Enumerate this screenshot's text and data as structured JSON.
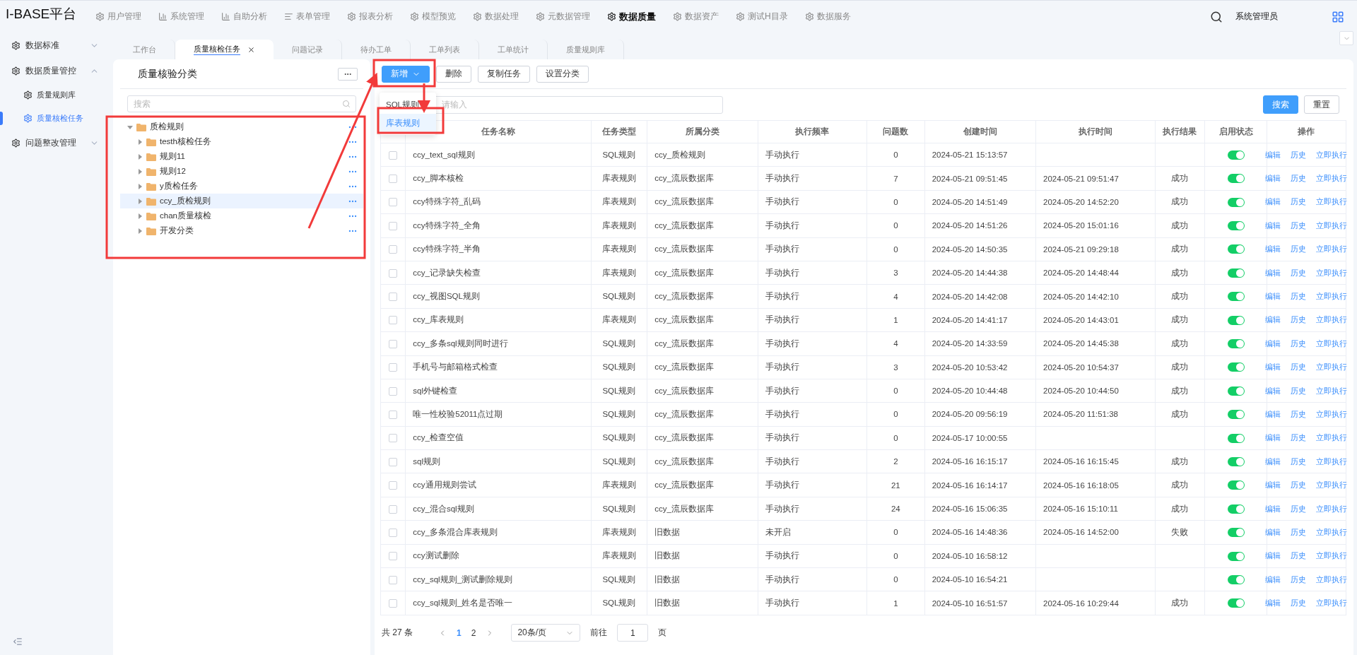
{
  "app": {
    "title": "I-BASE平台"
  },
  "nav": [
    {
      "label": "用户管理",
      "kind": "gear",
      "selected": false
    },
    {
      "label": "系统管理",
      "kind": "bars",
      "selected": false
    },
    {
      "label": "自助分析",
      "kind": "bars",
      "selected": false
    },
    {
      "label": "表单管理",
      "kind": "list",
      "selected": false
    },
    {
      "label": "报表分析",
      "kind": "gear",
      "selected": false
    },
    {
      "label": "模型预览",
      "kind": "gear",
      "selected": false
    },
    {
      "label": "数据处理",
      "kind": "gear",
      "selected": false
    },
    {
      "label": "元数据管理",
      "kind": "gear",
      "selected": false
    },
    {
      "label": "数据质量",
      "kind": "gear",
      "selected": true
    },
    {
      "label": "数据资产",
      "kind": "gear",
      "selected": false
    },
    {
      "label": "测试H目录",
      "kind": "gear",
      "selected": false
    },
    {
      "label": "数据服务",
      "kind": "gear",
      "selected": false
    }
  ],
  "user": {
    "name": "系统管理员"
  },
  "tabs": [
    {
      "label": "工作台",
      "selected": false
    },
    {
      "label": "质量核检任务",
      "selected": true
    },
    {
      "label": "问题记录",
      "selected": false
    },
    {
      "label": "待办工单",
      "selected": false
    },
    {
      "label": "工单列表",
      "selected": false
    },
    {
      "label": "工单统计",
      "selected": false
    },
    {
      "label": "质量规则库",
      "selected": false
    }
  ],
  "sidebar": {
    "items": [
      {
        "label": "数据标准",
        "expanded": false
      },
      {
        "label": "数据质量管控",
        "expanded": true,
        "children": [
          {
            "label": "质量规则库",
            "selected": false
          },
          {
            "label": "质量核检任务",
            "selected": true
          }
        ]
      },
      {
        "label": "问题整改管理",
        "expanded": false
      }
    ]
  },
  "tree_panel": {
    "title": "质量核验分类",
    "search": {
      "placeholder": "搜索"
    },
    "nodes": [
      {
        "label": "质检规则",
        "expanded": true,
        "selected": false,
        "children": [
          {
            "label": "testh核检任务",
            "expanded": false,
            "selected": false
          },
          {
            "label": "规则11",
            "expanded": false,
            "selected": false
          },
          {
            "label": "规则12",
            "expanded": false,
            "selected": false
          },
          {
            "label": "y质检任务",
            "expanded": false,
            "selected": false
          },
          {
            "label": "ccy_质检规则",
            "expanded": false,
            "selected": true
          },
          {
            "label": "chan质量核检",
            "expanded": false,
            "selected": false
          },
          {
            "label": "开发分类",
            "expanded": false,
            "selected": false
          }
        ]
      }
    ]
  },
  "toolbar": {
    "buttons": [
      {
        "label": "新增",
        "kind": "primary"
      },
      {
        "label": "删除",
        "kind": "plain"
      },
      {
        "label": "复制任务",
        "kind": "plain"
      },
      {
        "label": "设置分类",
        "kind": "plain"
      }
    ]
  },
  "dropdown": {
    "items": [
      {
        "label": "SQL规则",
        "highlighted": false
      },
      {
        "label": "库表规则",
        "highlighted": true
      }
    ]
  },
  "search": {
    "placeholder": "请输入",
    "buttons": [
      {
        "label": "搜索",
        "kind": "primary"
      },
      {
        "label": "重置",
        "kind": "plain"
      }
    ]
  },
  "table": {
    "columns": [
      "任务名称",
      "任务类型",
      "所属分类",
      "执行频率",
      "问题数",
      "创建时间",
      "执行时间",
      "执行结果",
      "启用状态",
      "操作"
    ],
    "rows": [
      {
        "checked": false,
        "name": "ccy_text_sql规则",
        "type": "SQL规则",
        "category": "ccy_质检规则",
        "frequency": "手动执行",
        "issues": "0",
        "created": "2024-05-21 15:13:57",
        "executed": "",
        "result": "",
        "enabled": true,
        "actions": [
          "编辑",
          "历史",
          "立即执行"
        ]
      },
      {
        "checked": false,
        "name": "ccy_脚本核检",
        "type": "库表规则",
        "category": "ccy_流辰数据库",
        "frequency": "手动执行",
        "issues": "7",
        "created": "2024-05-21 09:51:45",
        "executed": "2024-05-21 09:51:47",
        "result": "成功",
        "enabled": true,
        "actions": [
          "编辑",
          "历史",
          "立即执行"
        ]
      },
      {
        "checked": false,
        "name": "ccy特殊字符_乱码",
        "type": "库表规则",
        "category": "ccy_流辰数据库",
        "frequency": "手动执行",
        "issues": "0",
        "created": "2024-05-20 14:51:49",
        "executed": "2024-05-20 14:52:20",
        "result": "成功",
        "enabled": true,
        "actions": [
          "编辑",
          "历史",
          "立即执行"
        ]
      },
      {
        "checked": false,
        "name": "ccy特殊字符_全角",
        "type": "库表规则",
        "category": "ccy_流辰数据库",
        "frequency": "手动执行",
        "issues": "0",
        "created": "2024-05-20 14:51:26",
        "executed": "2024-05-20 15:01:16",
        "result": "成功",
        "enabled": true,
        "actions": [
          "编辑",
          "历史",
          "立即执行"
        ]
      },
      {
        "checked": false,
        "name": "ccy特殊字符_半角",
        "type": "库表规则",
        "category": "ccy_流辰数据库",
        "frequency": "手动执行",
        "issues": "0",
        "created": "2024-05-20 14:50:35",
        "executed": "2024-05-21 09:29:18",
        "result": "成功",
        "enabled": true,
        "actions": [
          "编辑",
          "历史",
          "立即执行"
        ]
      },
      {
        "checked": false,
        "name": "ccy_记录缺失检查",
        "type": "库表规则",
        "category": "ccy_流辰数据库",
        "frequency": "手动执行",
        "issues": "3",
        "created": "2024-05-20 14:44:38",
        "executed": "2024-05-20 14:48:44",
        "result": "成功",
        "enabled": true,
        "actions": [
          "编辑",
          "历史",
          "立即执行"
        ]
      },
      {
        "checked": false,
        "name": "ccy_视图SQL规则",
        "type": "SQL规则",
        "category": "ccy_流辰数据库",
        "frequency": "手动执行",
        "issues": "4",
        "created": "2024-05-20 14:42:08",
        "executed": "2024-05-20 14:42:10",
        "result": "成功",
        "enabled": true,
        "actions": [
          "编辑",
          "历史",
          "立即执行"
        ]
      },
      {
        "checked": false,
        "name": "ccy_库表规则",
        "type": "库表规则",
        "category": "ccy_流辰数据库",
        "frequency": "手动执行",
        "issues": "1",
        "created": "2024-05-20 14:41:17",
        "executed": "2024-05-20 14:43:01",
        "result": "成功",
        "enabled": true,
        "actions": [
          "编辑",
          "历史",
          "立即执行"
        ]
      },
      {
        "checked": false,
        "name": "ccy_多条sql规则同时进行",
        "type": "SQL规则",
        "category": "ccy_流辰数据库",
        "frequency": "手动执行",
        "issues": "4",
        "created": "2024-05-20 14:33:59",
        "executed": "2024-05-20 14:45:38",
        "result": "成功",
        "enabled": true,
        "actions": [
          "编辑",
          "历史",
          "立即执行"
        ]
      },
      {
        "checked": false,
        "name": "手机号与邮箱格式检查",
        "type": "SQL规则",
        "category": "ccy_流辰数据库",
        "frequency": "手动执行",
        "issues": "3",
        "created": "2024-05-20 10:53:42",
        "executed": "2024-05-20 10:54:37",
        "result": "成功",
        "enabled": true,
        "actions": [
          "编辑",
          "历史",
          "立即执行"
        ]
      },
      {
        "checked": false,
        "name": "sql外键检查",
        "type": "SQL规则",
        "category": "ccy_流辰数据库",
        "frequency": "手动执行",
        "issues": "0",
        "created": "2024-05-20 10:44:48",
        "executed": "2024-05-20 10:44:50",
        "result": "成功",
        "enabled": true,
        "actions": [
          "编辑",
          "历史",
          "立即执行"
        ]
      },
      {
        "checked": false,
        "name": "唯一性校验52011点过期",
        "type": "SQL规则",
        "category": "ccy_流辰数据库",
        "frequency": "手动执行",
        "issues": "0",
        "created": "2024-05-20 09:56:19",
        "executed": "2024-05-20 11:51:38",
        "result": "成功",
        "enabled": true,
        "actions": [
          "编辑",
          "历史",
          "立即执行"
        ]
      },
      {
        "checked": false,
        "name": "ccy_检查空值",
        "type": "SQL规则",
        "category": "ccy_流辰数据库",
        "frequency": "手动执行",
        "issues": "0",
        "created": "2024-05-17 10:00:55",
        "executed": "",
        "result": "",
        "enabled": true,
        "actions": [
          "编辑",
          "历史",
          "立即执行"
        ]
      },
      {
        "checked": false,
        "name": "sql规则",
        "type": "SQL规则",
        "category": "ccy_流辰数据库",
        "frequency": "手动执行",
        "issues": "2",
        "created": "2024-05-16 16:15:17",
        "executed": "2024-05-16 16:15:45",
        "result": "成功",
        "enabled": true,
        "actions": [
          "编辑",
          "历史",
          "立即执行"
        ]
      },
      {
        "checked": false,
        "name": "ccy通用规则尝试",
        "type": "库表规则",
        "category": "ccy_流辰数据库",
        "frequency": "手动执行",
        "issues": "21",
        "created": "2024-05-16 16:14:17",
        "executed": "2024-05-16 16:18:05",
        "result": "成功",
        "enabled": true,
        "actions": [
          "编辑",
          "历史",
          "立即执行"
        ]
      },
      {
        "checked": false,
        "name": "ccy_混合sql规则",
        "type": "SQL规则",
        "category": "ccy_流辰数据库",
        "frequency": "手动执行",
        "issues": "24",
        "created": "2024-05-16 15:06:35",
        "executed": "2024-05-16 15:10:11",
        "result": "成功",
        "enabled": true,
        "actions": [
          "编辑",
          "历史",
          "立即执行"
        ]
      },
      {
        "checked": false,
        "name": "ccy_多条混合库表规则",
        "type": "库表规则",
        "category": "旧数据",
        "frequency": "未开启",
        "issues": "0",
        "created": "2024-05-16 14:48:36",
        "executed": "2024-05-16 14:52:00",
        "result": "失败",
        "enabled": true,
        "actions": [
          "编辑",
          "历史",
          "立即执行"
        ]
      },
      {
        "checked": false,
        "name": "ccy测试删除",
        "type": "库表规则",
        "category": "旧数据",
        "frequency": "手动执行",
        "issues": "0",
        "created": "2024-05-10 16:58:12",
        "executed": "",
        "result": "",
        "enabled": true,
        "actions": [
          "编辑",
          "历史",
          "立即执行"
        ]
      },
      {
        "checked": false,
        "name": "ccy_sql规则_测试删除规则",
        "type": "SQL规则",
        "category": "旧数据",
        "frequency": "手动执行",
        "issues": "0",
        "created": "2024-05-10 16:54:21",
        "executed": "",
        "result": "",
        "enabled": true,
        "actions": [
          "编辑",
          "历史",
          "立即执行"
        ]
      },
      {
        "checked": false,
        "name": "ccy_sql规则_姓名是否唯一",
        "type": "SQL规则",
        "category": "旧数据",
        "frequency": "手动执行",
        "issues": "1",
        "created": "2024-05-10 16:51:57",
        "executed": "2024-05-16 10:29:44",
        "result": "成功",
        "enabled": true,
        "actions": [
          "编辑",
          "历史",
          "立即执行"
        ]
      }
    ]
  },
  "pagination": {
    "total": "共 27 条",
    "pages": [
      {
        "label": "1",
        "selected": true
      },
      {
        "label": "2",
        "selected": false
      }
    ],
    "page_size": "20条/页",
    "goto_label": "前往",
    "goto_value": "1",
    "goto_suffix": "页"
  }
}
